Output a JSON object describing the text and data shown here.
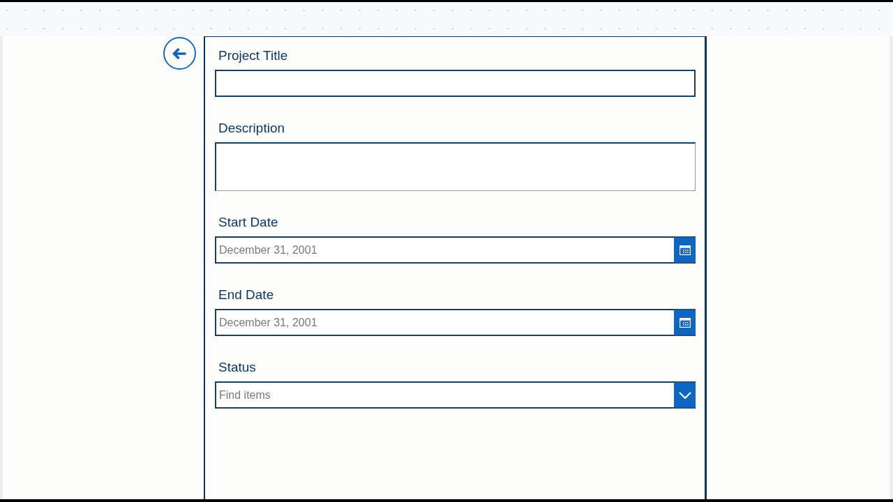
{
  "form": {
    "fields": [
      {
        "kind": "text",
        "label": "Project Title"
      },
      {
        "kind": "textarea",
        "label": "Description"
      },
      {
        "kind": "date",
        "label": "Start Date",
        "placeholder": "December 31, 2001"
      },
      {
        "kind": "date",
        "label": "End Date",
        "placeholder": "December 31, 2001"
      },
      {
        "kind": "dropdown",
        "label": "Status",
        "placeholder": "Find items"
      }
    ]
  }
}
